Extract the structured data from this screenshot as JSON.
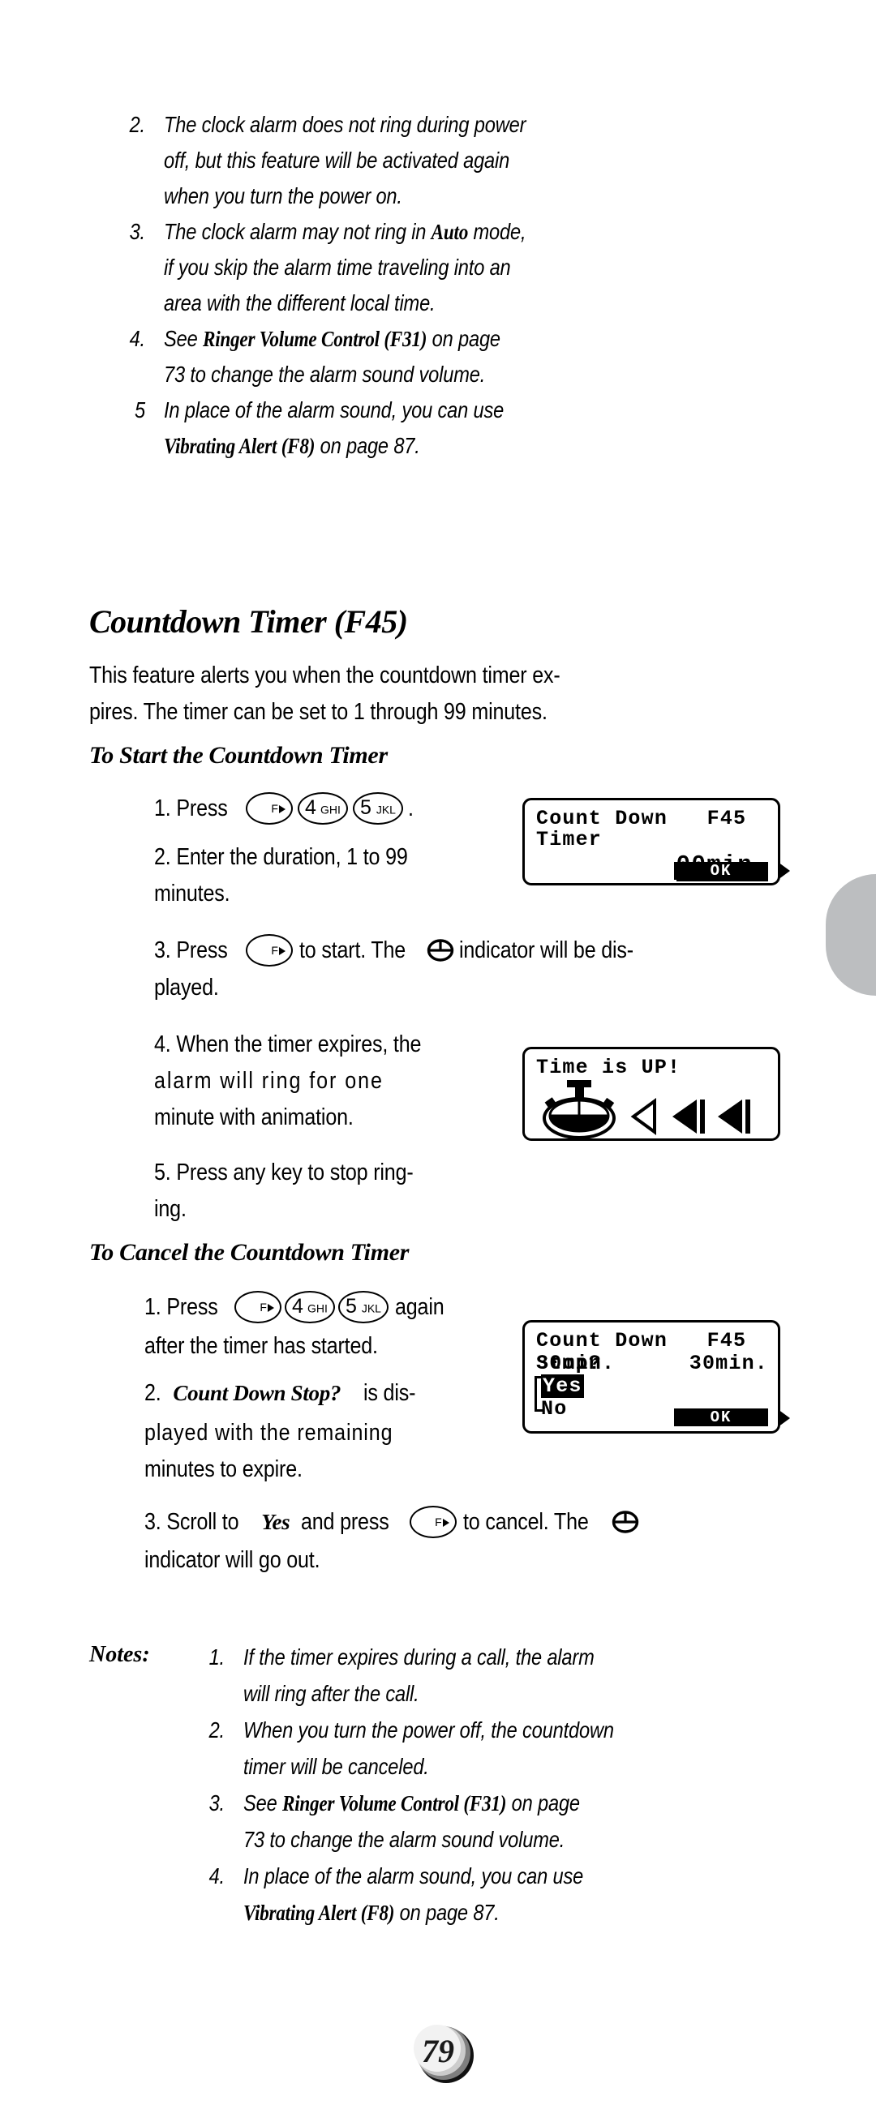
{
  "page": {
    "number": "79"
  },
  "top_notes": [
    {
      "num": "2.",
      "lines": [
        "The clock alarm does not ring during power",
        "off, but this feature will be activated again",
        "when you turn the power on."
      ]
    },
    {
      "num": "3.",
      "lines_rich": [
        [
          {
            "t": "The clock alarm may not ring in ",
            "s": "i"
          },
          {
            "t": "Auto",
            "s": "ref"
          },
          {
            "t": "  mode,",
            "s": "i"
          }
        ],
        [
          {
            "t": "if you skip the alarm time traveling into an",
            "s": "i"
          }
        ],
        [
          {
            "t": "area with the different local time.",
            "s": "i"
          }
        ]
      ]
    },
    {
      "num": "4.",
      "lines_rich": [
        [
          {
            "t": "See ",
            "s": "i"
          },
          {
            "t": "Ringer Volume Control (F31)",
            "s": "ref"
          },
          {
            "t": "   on page",
            "s": "i"
          }
        ],
        [
          {
            "t": "73 to change the alarm sound volume.",
            "s": "i"
          }
        ]
      ]
    },
    {
      "num": "5",
      "lines_rich": [
        [
          {
            "t": "In place of the alarm sound, you can use",
            "s": "i"
          }
        ],
        [
          {
            "t": "Vibrating Alert (F8)",
            "s": "ref"
          },
          {
            "t": "  on page 87.",
            "s": "i"
          }
        ]
      ]
    }
  ],
  "section": {
    "title": "Countdown Timer (F45)",
    "intro": [
      "This feature alerts you when the countdown timer ex-",
      "pires. The timer can be set to 1 through 99 minutes."
    ],
    "start_heading": "To Start the Countdown Timer",
    "cancel_heading": "To Cancel the Countdown Timer"
  },
  "keys": {
    "f_label": "F",
    "four_digit": "4",
    "four_alpha": "GHI",
    "five_digit": "5",
    "five_alpha": "JKL"
  },
  "start_steps": {
    "s1_pre": "1. Press",
    "s1_post": ".",
    "s2_l1": "2. Enter the duration, 1 to 99",
    "s2_l2": "minutes.",
    "s3_pre": "3. Press",
    "s3_mid": "to start. The",
    "s3_post": "indicator will be dis-",
    "s3_l2": "played.",
    "s4_l1": "4. When the timer expires, the",
    "s4_l2": "alarm will ring for one",
    "s4_l3": "minute with animation.",
    "s5_l1": "5. Press any key to stop ring-",
    "s5_l2": "ing."
  },
  "cancel_steps": {
    "c1_pre": "1. Press",
    "c1_post": "again",
    "c1_l2": "after the timer has started.",
    "c2_num": "2.",
    "c2_ref": "Count Down Stop?",
    "c2_tail": "is dis-",
    "c2_l2": "played with the remaining",
    "c2_l3": "minutes to expire.",
    "c3_pre": "3. Scroll to",
    "c3_yes": "Yes",
    "c3_mid": "and press",
    "c3_post": "to cancel. The",
    "c3_l2": "indicator will go out."
  },
  "lcd_start": {
    "line1": "Count Down   F45",
    "line2": "Timer",
    "value": "00min.",
    "ok": "OK"
  },
  "lcd_timeup": {
    "line1": "Time is UP!"
  },
  "lcd_stop": {
    "line1": "Count Down   F45",
    "line2_left": "Stop?",
    "line2_right": "30min.",
    "option_yes": "Yes",
    "option_no": "No",
    "ok": "OK"
  },
  "bottom_notes": {
    "label": "Notes:",
    "items": [
      {
        "num": "1.",
        "lines_rich": [
          [
            {
              "t": "If the timer expires during a call, the alarm",
              "s": "i"
            }
          ],
          [
            {
              "t": "will ring after the call.",
              "s": "i"
            }
          ]
        ]
      },
      {
        "num": "2.",
        "lines_rich": [
          [
            {
              "t": "When you turn the power off, the countdown",
              "s": "i"
            }
          ],
          [
            {
              "t": "timer will be canceled.",
              "s": "i"
            }
          ]
        ]
      },
      {
        "num": "3.",
        "lines_rich": [
          [
            {
              "t": "See ",
              "s": "i"
            },
            {
              "t": "Ringer Volume Control (F31)",
              "s": "ref"
            },
            {
              "t": "   on page",
              "s": "i"
            }
          ],
          [
            {
              "t": "73 to change the alarm sound volume.",
              "s": "i"
            }
          ]
        ]
      },
      {
        "num": "4.",
        "lines_rich": [
          [
            {
              "t": "In place of the alarm sound, you can use",
              "s": "i"
            }
          ],
          [
            {
              "t": "Vibrating Alert (F8)",
              "s": "ref"
            },
            {
              "t": "  on page 87.",
              "s": "i"
            }
          ]
        ]
      }
    ]
  }
}
